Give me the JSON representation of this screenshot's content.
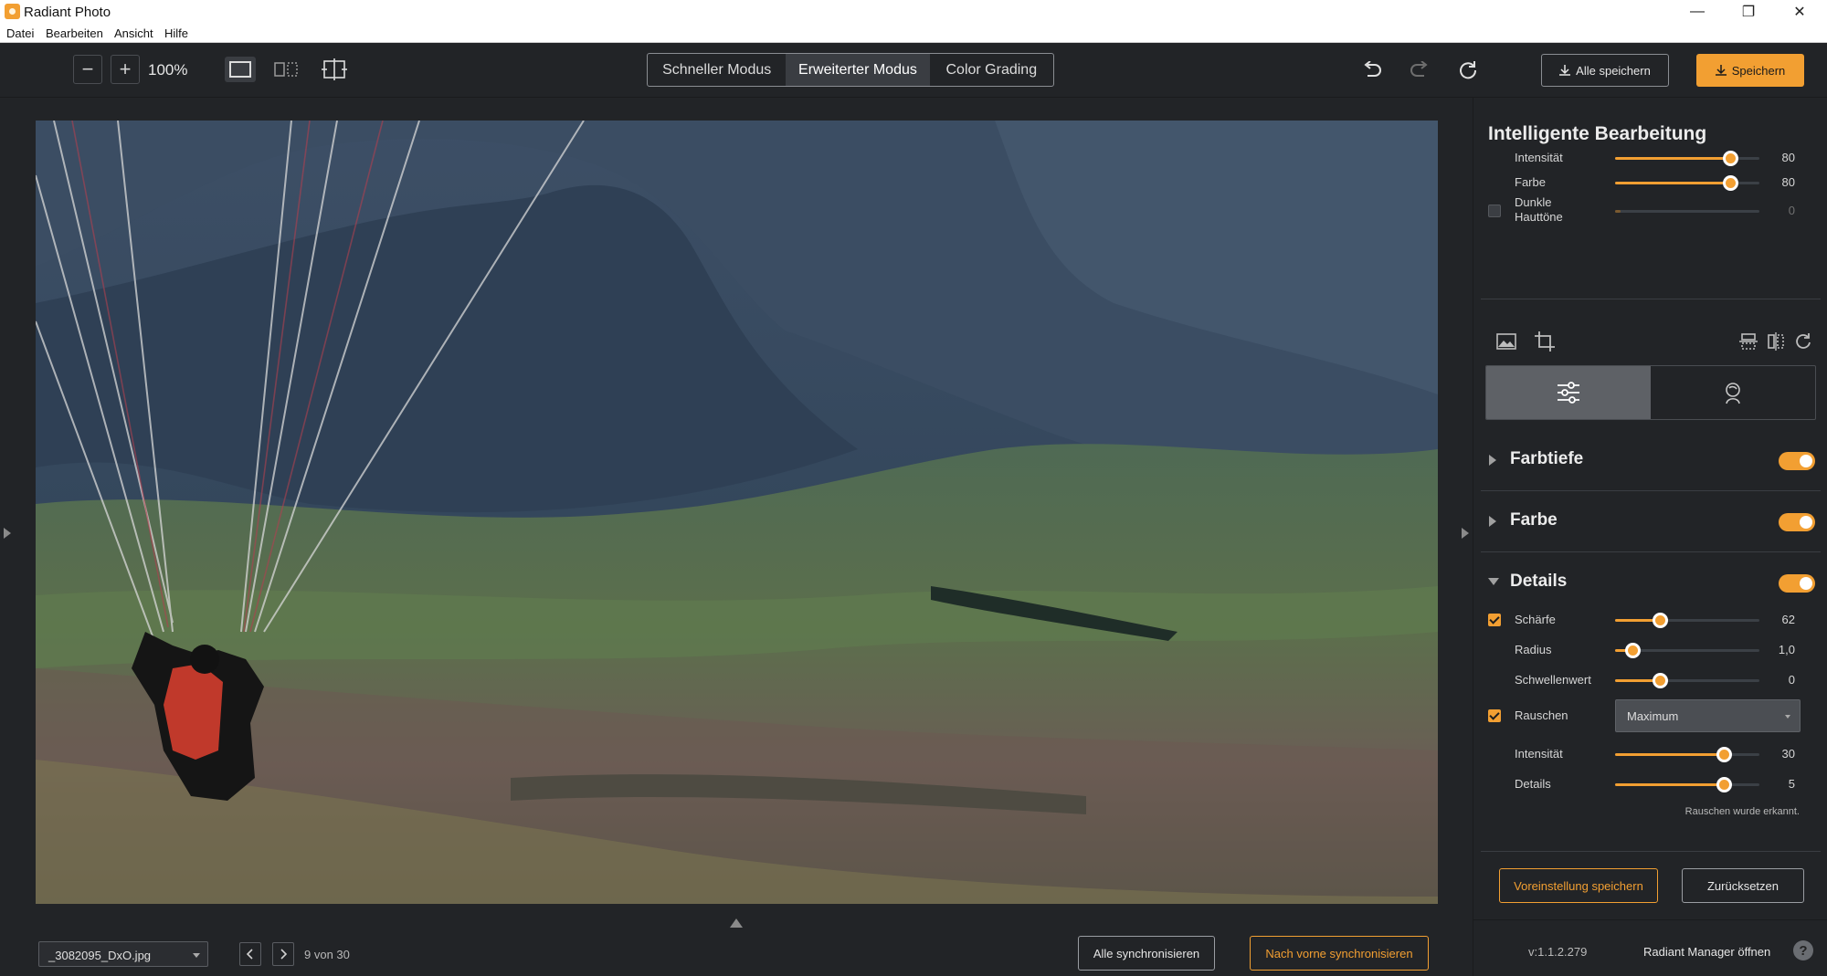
{
  "window": {
    "title": "Radiant Photo",
    "minimize_glyph": "—",
    "maximize_glyph": "❐",
    "close_glyph": "✕"
  },
  "menu": [
    "Datei",
    "Bearbeiten",
    "Ansicht",
    "Hilfe"
  ],
  "toolbar": {
    "zoom_out_glyph": "−",
    "zoom_in_glyph": "+",
    "zoom": "100%",
    "modes": [
      "Schneller Modus",
      "Erweiterter Modus",
      "Color Grading"
    ],
    "active_mode": "Erweiterter Modus",
    "save_all": "Alle speichern",
    "save": "Speichern"
  },
  "canvas": {
    "file_name": "_3082095_DxO.jpg",
    "counter": "9 von 30",
    "sync_all": "Alle synchronisieren",
    "sync_forward": "Nach vorne synchronisieren"
  },
  "panel": {
    "title": "Intelligente Bearbeitung",
    "smart": [
      {
        "label": "Intensität",
        "value": "80",
        "level": 0.8,
        "enabled": true
      },
      {
        "label": "Farbe",
        "value": "80",
        "level": 0.8,
        "enabled": true
      },
      {
        "label": "Dunkle Hauttöne",
        "value": "0",
        "level": 0.0,
        "enabled": false
      }
    ],
    "sections": {
      "farbtiefe": "Farbtiefe",
      "farbe": "Farbe",
      "details": "Details"
    },
    "details": [
      {
        "label": "Schärfe",
        "value": "62",
        "level": 0.31
      },
      {
        "label": "Radius",
        "value": "1,0",
        "level": 0.12
      },
      {
        "label": "Schwellenwert",
        "value": "0",
        "level": 0.31
      }
    ],
    "noise": {
      "label": "Rauschen",
      "mode": "Maximum",
      "sliders": [
        {
          "label": "Intensität",
          "value": "30",
          "level": 0.75
        },
        {
          "label": "Details",
          "value": "5",
          "level": 0.75
        }
      ],
      "note": "Rauschen wurde erkannt."
    },
    "save_preset": "Voreinstellung speichern",
    "reset": "Zurücksetzen",
    "version": "v:1.1.2.279",
    "manager": "Radiant Manager öffnen",
    "help_glyph": "?"
  },
  "colors": {
    "accent": "#f29f32",
    "background": "#222427",
    "panel_line": "#3a3d42"
  }
}
